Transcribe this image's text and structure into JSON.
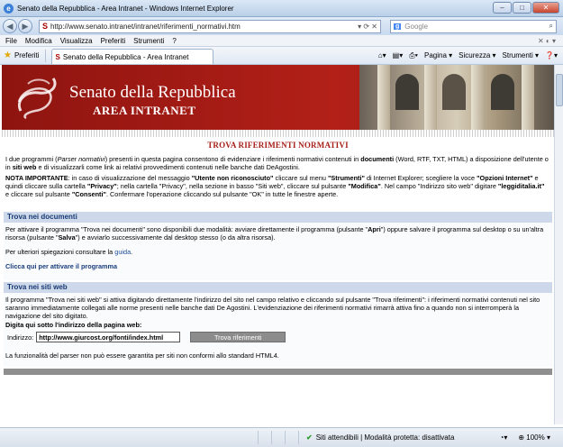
{
  "window": {
    "title": "Senato della Repubblica - Area Intranet - Windows Internet Explorer"
  },
  "address_bar": {
    "url": "http://www.senato.intranet/intranet/riferimenti_normativi.htm",
    "search_placeholder": "Google"
  },
  "menu": {
    "items": [
      "File",
      "Modifica",
      "Visualizza",
      "Preferiti",
      "Strumenti",
      "?"
    ]
  },
  "favorites_bar": {
    "favorites_label": "Preferiti",
    "tab_title": "Senato della Repubblica - Area Intranet",
    "commands": [
      "Pagina ▾",
      "Sicurezza ▾",
      "Strumenti ▾"
    ]
  },
  "banner": {
    "title": "Senato della Repubblica",
    "subtitle": "AREA INTRANET"
  },
  "content": {
    "page_title": "TROVA RIFERIMENTI NORMATIVI",
    "intro": {
      "p1": "I due programmi (",
      "p1_em": "Parser normativi",
      "p2": ") presenti in questa pagina consentono di evidenziare i riferimenti normativi contenuti in ",
      "p2_b": "documenti",
      "p3": " (Word, RTF, TXT, HTML) a disposizione dell'utente o in ",
      "p3_b": "siti web",
      "p4": " e di visualizzarli come link ai relativi provvedimenti contenuti nelle banche dati DeAgostini."
    },
    "note": {
      "n1": "NOTA IMPORTANTE",
      "n2": ": in caso di visualizzazione del messaggio ",
      "n3": "\"Utente non riconosciuto\"",
      "n4": " cliccare sul menu ",
      "n5": "\"Strumenti\"",
      "n6": " di Internet Explorer; scegliere la voce ",
      "n7": "\"Opzioni Internet\"",
      "n8": " e quindi cliccare sulla cartella ",
      "n9": "\"Privacy\"",
      "n10": "; nella cartella \"Privacy\", nella sezione in basso \"Siti web\", cliccare sul pulsante ",
      "n11": "\"Modifica\"",
      "n12": ". Nel campo \"Indirizzo sito web\" digitare ",
      "n13": "\"leggiditalia.it\"",
      "n14": " e cliccare sul pulsante ",
      "n15": "\"Consenti\"",
      "n16": ". Confermare l'operazione cliccando sul pulsante \"OK\" in tutte le finestre aperte."
    },
    "section_docs": {
      "heading": "Trova nei documenti",
      "t1": "Per attivare il programma \"Trova nei documenti\" sono disponibili due modalità: avviare direttamente il programma (pulsante \"",
      "t1_b": "Apri",
      "t2": "\") oppure salvare il programma sul desktop o su un'altra risorsa (pulsante \"",
      "t2_b": "Salva",
      "t3": "\") e avviarlo successivamente dal desktop stesso (o da altra risorsa).",
      "guide_prefix": "Per ulteriori spiegazioni consultare la ",
      "guide_link": "guida",
      "guide_suffix": ".",
      "activate_link": "Clicca qui per attivare il programma"
    },
    "section_web": {
      "heading": "Trova nei siti web",
      "text": "Il programma \"Trova nei siti web\" si attiva digitando direttamente l'indirizzo del sito nel campo relativo e cliccando sul pulsante \"Trova riferimenti\": i riferimenti normativi contenuti nel sito saranno immediatamente collegati alle norme presenti nelle banche dati De Agostini. L'evidenziazione dei riferimenti normativi rimarrà attiva fino a quando non si interromperà la navigazione del sito digitato.",
      "input_heading": "Digita qui sotto l'indirizzo della pagina web:",
      "input_label": "Indirizzo:",
      "input_value": "http://www.giurcost.org/fonti/index.html",
      "button_label": "Trova riferimenti",
      "disclaimer": "La funzionalità del parser non può essere garantita per siti non conformi allo standard HTML4."
    }
  },
  "status_bar": {
    "zone": "Siti attendibili | Modalità protetta: disattivata",
    "zoom": "100%"
  }
}
